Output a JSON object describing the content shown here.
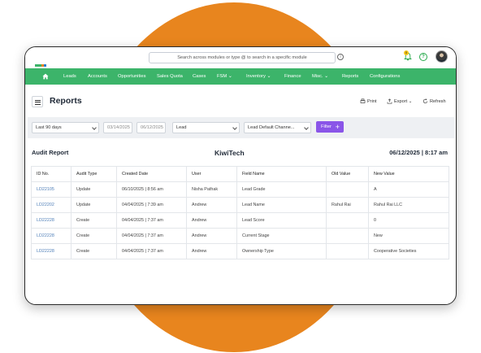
{
  "colors": {
    "accent_green": "#3cb46a",
    "filter_purple": "#8a55e8",
    "backdrop_orange": "#e8851e"
  },
  "topbar": {
    "search_placeholder": "Search across modules or type @ to search in a specific module",
    "notification_count": "0"
  },
  "nav": {
    "items": [
      {
        "label": "Leads"
      },
      {
        "label": "Accounts"
      },
      {
        "label": "Opportunities"
      },
      {
        "label": "Sales Quota"
      },
      {
        "label": "Cases"
      },
      {
        "label": "FSM"
      },
      {
        "label": "Inventory"
      },
      {
        "label": "Finance"
      },
      {
        "label": "Misc."
      },
      {
        "label": "Reports"
      },
      {
        "label": "Configurations"
      }
    ]
  },
  "page": {
    "title": "Reports",
    "print_label": "Print",
    "export_label": "Export",
    "refresh_label": "Refresh"
  },
  "filters": {
    "range": "Last 90 days",
    "from_date": "03/14/2025",
    "to_date": "06/12/2025",
    "module": "Lead",
    "channel": "Lead Default Channe...",
    "filter_label": "Filter"
  },
  "report": {
    "name": "Audit Report",
    "company": "KiwiTech",
    "timestamp": "06/12/2025 | 8:17 am",
    "columns": [
      "ID No.",
      "Audit Type",
      "Created Date",
      "User",
      "Field Name",
      "Old Value",
      "New Value"
    ],
    "rows": [
      [
        "LD22105",
        "Update",
        "06/10/2025 | 8:56 am",
        "Nisha Pathak",
        "Lead Grade",
        "",
        "A"
      ],
      [
        "LD22202",
        "Update",
        "04/04/2025 | 7:39 am",
        "Andrew",
        "Lead Name",
        "Rahul Rai",
        "Rahul Rai LLC"
      ],
      [
        "LD22228",
        "Create",
        "04/04/2025 | 7:37 am",
        "Andrew",
        "Lead Score",
        "",
        "0"
      ],
      [
        "LD22228",
        "Create",
        "04/04/2025 | 7:37 am",
        "Andrew",
        "Current Stage",
        "",
        "New"
      ],
      [
        "LD22228",
        "Create",
        "04/04/2025 | 7:37 am",
        "Andrew",
        "Ownership Type",
        "",
        "Cooperative Societies"
      ]
    ]
  }
}
